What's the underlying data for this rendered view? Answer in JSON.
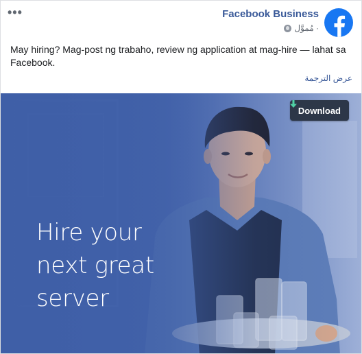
{
  "post": {
    "more_label": "•••",
    "page_name": "Facebook Business",
    "sponsored_label": "مُموَّل ·",
    "text": "May hiring? Mag-post ng trabaho, review ng application at mag-hire — lahat sa Facebook.",
    "see_translation": "عرض الترجمة"
  },
  "media": {
    "headline": [
      "Hire your",
      "next great",
      "server"
    ],
    "download_label": "Download"
  },
  "icons": {
    "more": "more-options-icon",
    "globe": "globe-icon",
    "avatar": "facebook-logo-icon",
    "download": "download-arrow-icon"
  },
  "colors": {
    "brand_blue": "#1877f2",
    "link_blue": "#385898",
    "overlay_blue": "#3f5fa7",
    "button_dark": "#2d3748",
    "download_arrow": "#4fd1a5"
  }
}
